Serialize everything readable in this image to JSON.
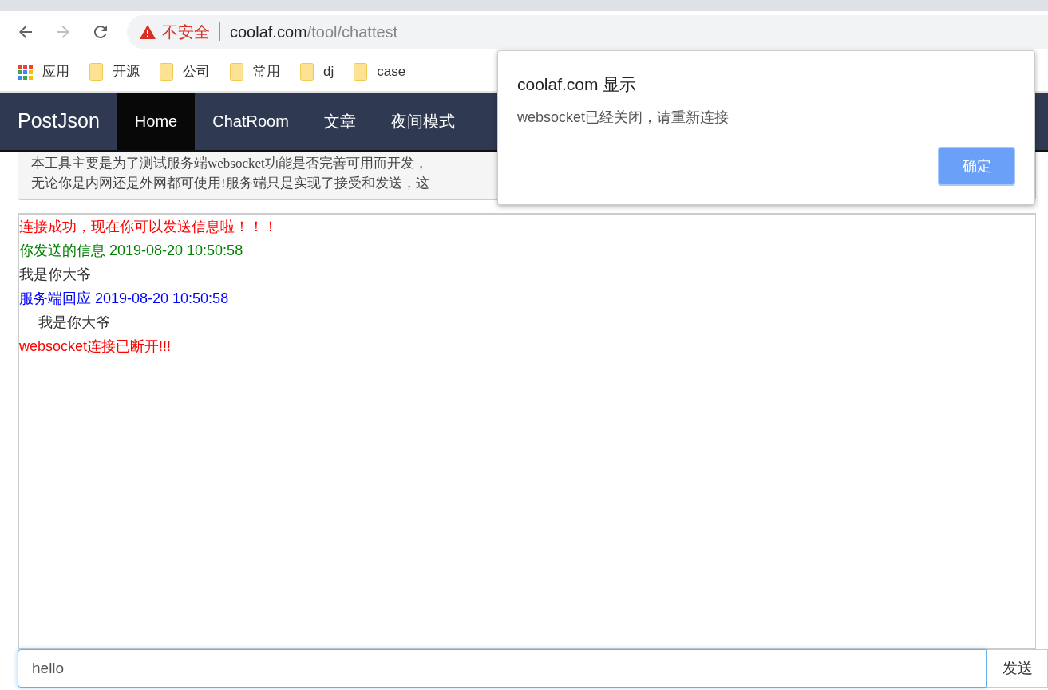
{
  "browser": {
    "nav_buttons": [
      {
        "kind": "back",
        "disabled": false
      },
      {
        "kind": "forward",
        "disabled": true
      },
      {
        "kind": "reload",
        "disabled": false
      }
    ],
    "security_label": "不安全",
    "url_host": "coolaf.com",
    "url_path": "/tool/chattest",
    "bookmarks": [
      {
        "kind": "apps",
        "label": "应用"
      },
      {
        "kind": "folder",
        "label": "开源"
      },
      {
        "kind": "folder",
        "label": "公司"
      },
      {
        "kind": "folder",
        "label": "常用"
      },
      {
        "kind": "folder",
        "label": "dj"
      },
      {
        "kind": "folder",
        "label": "case"
      }
    ]
  },
  "navbar": {
    "brand": "PostJson",
    "items": [
      {
        "label": "Home",
        "selected": true
      },
      {
        "label": "ChatRoom",
        "selected": false
      },
      {
        "label": "文章",
        "selected": false
      },
      {
        "label": "夜间模式",
        "selected": false
      }
    ]
  },
  "intro": [
    "本工具主要是为了测试服务端websocket功能是否完善可用而开发，",
    "无论你是内网还是外网都可使用!服务端只是实现了接受和发送，这"
  ],
  "messages": [
    {
      "kind": "line",
      "text": "连接成功，现在你可以发送信息啦！！！",
      "color": "#ff0000"
    },
    {
      "kind": "line",
      "text": "你发送的信息 2019-08-20 10:50:58",
      "color": "#008000"
    },
    {
      "kind": "line",
      "text": "我是你大爷",
      "color": "#333333"
    },
    {
      "kind": "line",
      "text": "服务端回应 2019-08-20 10:50:58",
      "color": "#0000ff"
    },
    {
      "kind": "indented",
      "text": "我是你大爷",
      "color": "#333333"
    },
    {
      "kind": "line",
      "text": "websocket连接已断开!!!",
      "color": "#ff0000"
    }
  ],
  "input": {
    "value": "hello",
    "send_button": "发送"
  },
  "dialog": {
    "title": "coolaf.com 显示",
    "message": "websocket已经关闭，请重新连接",
    "button": "确定"
  }
}
